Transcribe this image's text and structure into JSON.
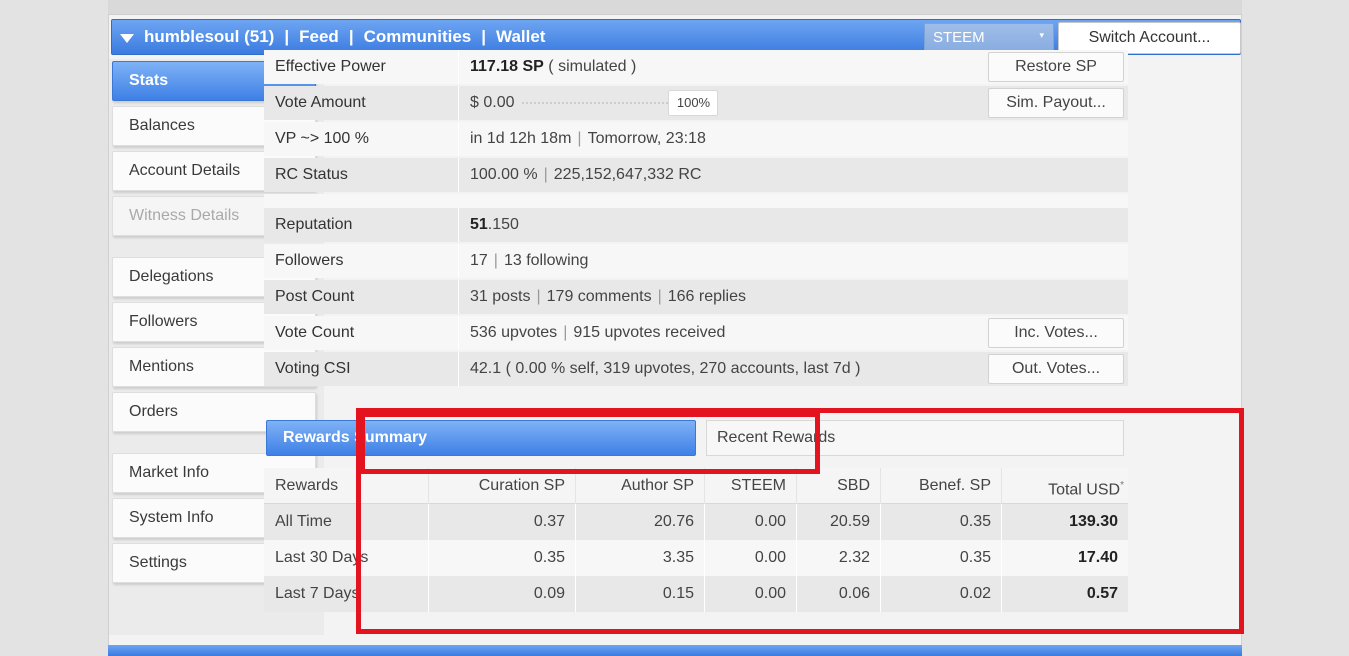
{
  "header": {
    "account": "humblesoul (51)",
    "nav": [
      "Feed",
      "Communities",
      "Wallet"
    ],
    "currency_select": "STEEM",
    "switch_account_label": "Switch Account..."
  },
  "sidebar": {
    "items": [
      {
        "label": "Stats",
        "state": "active"
      },
      {
        "label": "Balances"
      },
      {
        "label": "Account Details"
      },
      {
        "label": "Witness Details",
        "state": "disabled"
      },
      {
        "label": "Delegations"
      },
      {
        "label": "Followers"
      },
      {
        "label": "Mentions"
      },
      {
        "label": "Orders"
      },
      {
        "label": "Market Info"
      },
      {
        "label": "System Info"
      },
      {
        "label": "Settings"
      }
    ]
  },
  "stats": {
    "effective_power": {
      "label": "Effective Power",
      "value": "117.18 SP",
      "note": "( simulated )",
      "button": "Restore SP"
    },
    "vote_amount": {
      "label": "Vote Amount",
      "value": "$ 0.00",
      "percent": "100%",
      "button": "Sim. Payout..."
    },
    "vp": {
      "label": "VP ~> 100 %",
      "value1": "in 1d 12h 18m",
      "value2": "Tomorrow, 23:18"
    },
    "rc": {
      "label": "RC Status",
      "value1": "100.00 %",
      "value2": "225,152,647,332 RC"
    },
    "reputation": {
      "label": "Reputation",
      "value_bold": "51",
      "value_rest": ".150"
    },
    "followers": {
      "label": "Followers",
      "value1": "17",
      "value2": "13 following"
    },
    "post_count": {
      "label": "Post Count",
      "value1": "31 posts",
      "value2": "179 comments",
      "value3": "166 replies"
    },
    "vote_count": {
      "label": "Vote Count",
      "value1": "536 upvotes",
      "value2": "915 upvotes received",
      "button": "Inc. Votes..."
    },
    "voting_csi": {
      "label": "Voting CSI",
      "value": "42.1 ( 0.00 % self, 319 upvotes, 270 accounts, last 7d )",
      "button": "Out. Votes..."
    }
  },
  "tabs": {
    "active": "Rewards Summary",
    "inactive": "Recent Rewards"
  },
  "rewards_table": {
    "headers": [
      "Rewards",
      "Curation SP",
      "Author SP",
      "STEEM",
      "SBD",
      "Benef. SP",
      "Total USD"
    ],
    "total_marker": "*",
    "rows": [
      [
        "All Time",
        "0.37",
        "20.76",
        "0.00",
        "20.59",
        "0.35",
        "139.30"
      ],
      [
        "Last 30 Days",
        "0.35",
        "3.35",
        "0.00",
        "2.32",
        "0.35",
        "17.40"
      ],
      [
        "Last 7 Days",
        "0.09",
        "0.15",
        "0.00",
        "0.06",
        "0.02",
        "0.57"
      ]
    ]
  },
  "colors": {
    "accent_blue": "#3e80e6",
    "highlight_red": "#e3141f"
  }
}
